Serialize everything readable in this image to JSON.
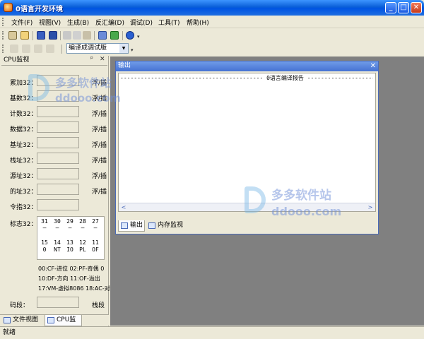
{
  "window": {
    "title": "0语言开发环境",
    "minimize": "_",
    "maximize": "□",
    "close": "✕"
  },
  "menu": [
    "文件(F)",
    "视图(V)",
    "生成(B)",
    "反汇编(D)",
    "调试(D)",
    "工具(T)",
    "帮助(H)"
  ],
  "toolbar2": {
    "build_mode": "编译成调试版"
  },
  "cpu_panel": {
    "title": "CPU监视",
    "controls": {
      "pin": "ᵖ",
      "close": "✕"
    },
    "registers": [
      {
        "label": "累加32：",
        "right": "浮/插"
      },
      {
        "label": "基数32：",
        "right": "浮/插"
      },
      {
        "label": "计数32：",
        "right": "浮/插"
      },
      {
        "label": "数据32：",
        "right": "浮/插"
      },
      {
        "label": "基址32：",
        "right": "浮/插"
      },
      {
        "label": "栈址32：",
        "right": "浮/插"
      },
      {
        "label": "源址32：",
        "right": "浮/插"
      },
      {
        "label": "的址32：",
        "right": "浮/插"
      },
      {
        "label": "令指32：",
        "right": ""
      }
    ],
    "flags_label": "标志32：",
    "flags_top": [
      {
        "num": "31",
        "val": "—"
      },
      {
        "num": "30",
        "val": "—"
      },
      {
        "num": "29",
        "val": "—"
      },
      {
        "num": "28",
        "val": "—"
      },
      {
        "num": "27",
        "val": "—"
      }
    ],
    "flags_bottom": [
      {
        "num": "15",
        "val": "0"
      },
      {
        "num": "14",
        "val": "NT"
      },
      {
        "num": "13",
        "val": "IO"
      },
      {
        "num": "12",
        "val": "PL"
      },
      {
        "num": "11",
        "val": "OF"
      }
    ],
    "legend": [
      "00:CF-进位  02:PF-奇偶  0",
      "10:DF-方向  11:OF-溢出",
      "17:VM-虚拟8086  18:AC-对"
    ],
    "code_seg_label": "码段：",
    "stack_seg_label": "栈段",
    "tabs": [
      "文件视图",
      "CPU监视"
    ]
  },
  "output": {
    "title": "输出",
    "close": "✕",
    "header": "------------------------------------------ 0语言编译报告 ------------------------------------------",
    "tabs": [
      "输出",
      "内存监视"
    ],
    "scroll_left": "<",
    "scroll_right": ">"
  },
  "status": {
    "text": "就绪"
  },
  "watermark": {
    "cn": "多多软件站",
    "url": "ddooo.com"
  },
  "colors": {
    "title_blue": "#0054e3",
    "mdi_gray": "#808080",
    "panel_bg": "#ece9d8"
  }
}
